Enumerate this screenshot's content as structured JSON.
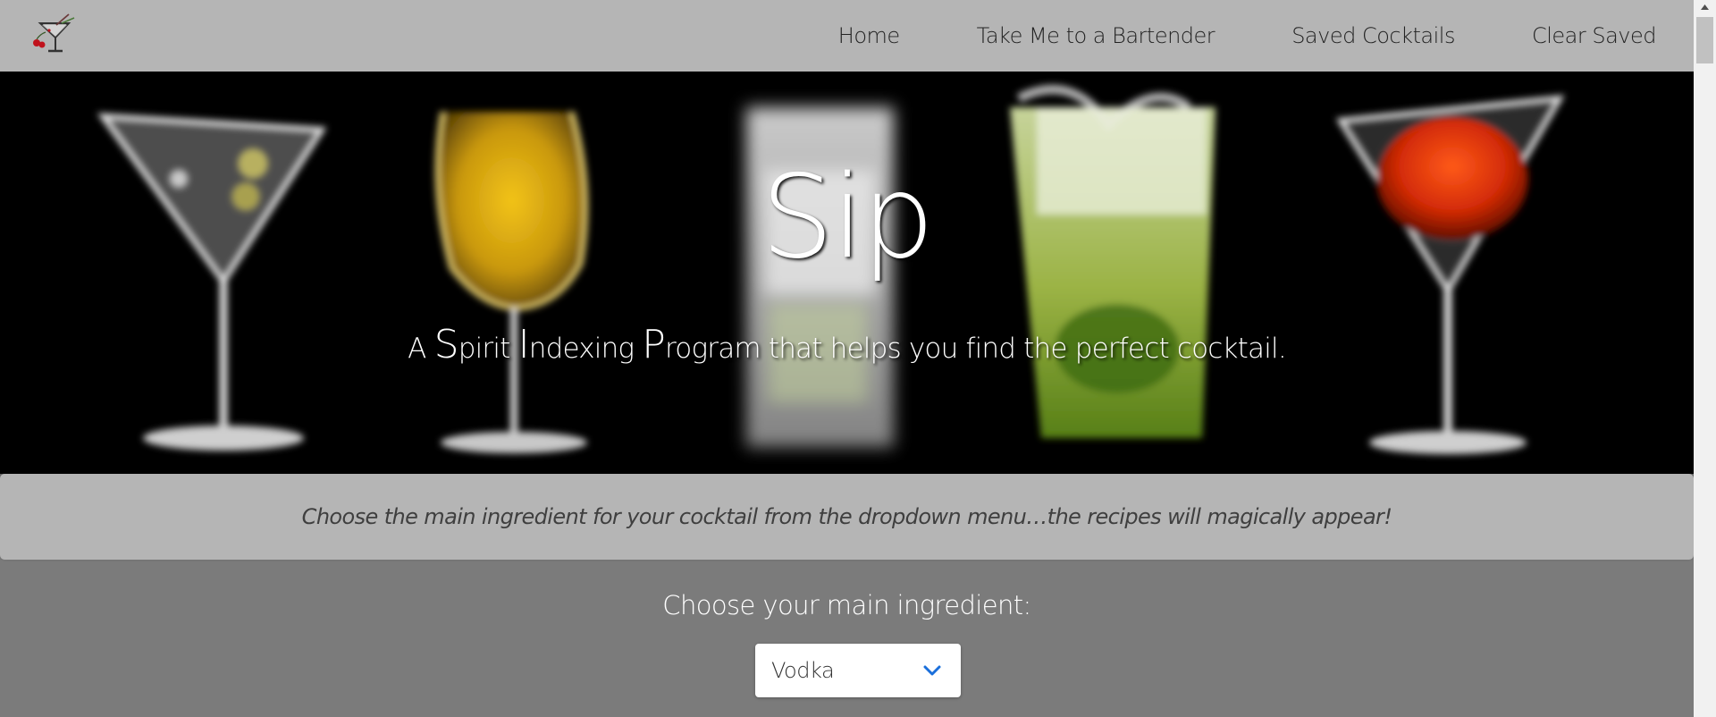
{
  "nav": {
    "logo_icon": "cocktail-glass-icon",
    "links": [
      {
        "label": "Home"
      },
      {
        "label": "Take Me to a Bartender"
      },
      {
        "label": "Saved Cocktails"
      },
      {
        "label": "Clear Saved"
      }
    ]
  },
  "hero": {
    "title": "Sip",
    "subtitle": {
      "p1": "A ",
      "s": "S",
      "p2": "pirit ",
      "i": "I",
      "p3": "ndexing ",
      "p": "P",
      "p4": "rogram that helps you find the perfect cocktail."
    }
  },
  "instructions": {
    "text": "Choose the main ingredient for your cocktail from the dropdown menu…the recipes will magically appear!"
  },
  "chooser": {
    "label": "Choose your main ingredient:",
    "selected": "Vodka",
    "arrow_icon": "chevron-down-icon"
  },
  "colors": {
    "navbar_bg": "#b5b5b5",
    "page_bg": "#7b7b7b",
    "instructions_bg": "#b5b5b5",
    "chevron": "#1a6fdb",
    "text_dark": "#222222",
    "text_light": "#ffffff"
  }
}
